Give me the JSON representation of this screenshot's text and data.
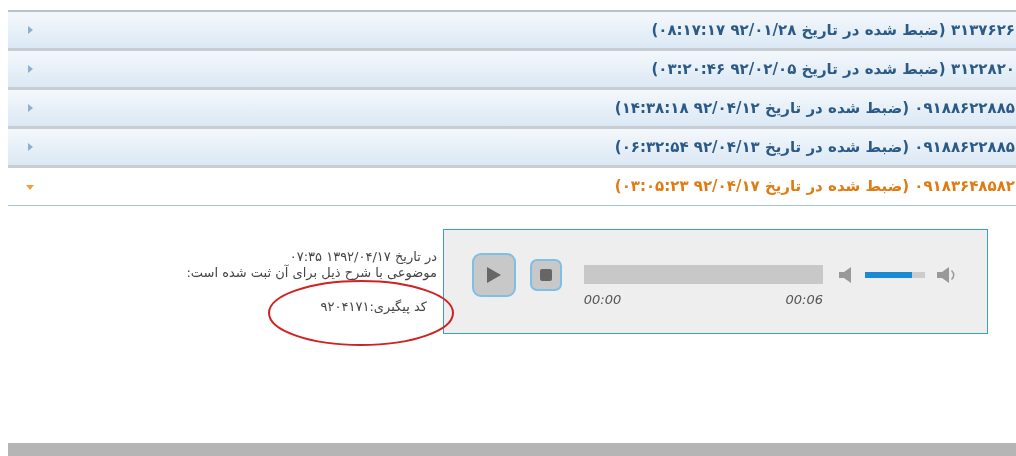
{
  "rows": [
    {
      "number": "۳۱۳۷۶۲۶",
      "label": "(ضبط شده در تاریخ ۹۲/۰۱/۲۸ ۰۸:۱۷:۱۷)",
      "expanded": false
    },
    {
      "number": "۳۱۲۲۸۲۰",
      "label": "(ضبط شده در تاریخ ۹۲/۰۲/۰۵ ۰۳:۲۰:۴۶)",
      "expanded": false
    },
    {
      "number": "۰۹۱۸۸۶۲۲۸۸۵",
      "label": "(ضبط شده در تاریخ ۹۲/۰۴/۱۲ ۱۴:۳۸:۱۸)",
      "expanded": false
    },
    {
      "number": "۰۹۱۸۸۶۲۲۸۸۵",
      "label": "(ضبط شده در تاریخ ۹۲/۰۴/۱۳ ۰۶:۳۲:۵۴)",
      "expanded": false
    },
    {
      "number": "۰۹۱۸۳۶۴۸۵۸۲",
      "label": "(ضبط شده در تاریخ ۹۲/۰۴/۱۷ ۰۳:۰۵:۲۳)",
      "expanded": true
    }
  ],
  "player": {
    "current_time": "00:00",
    "duration": "00:06",
    "volume": {
      "level": 0.78
    }
  },
  "details": {
    "date_line": "در تاریخ ۱۳۹۲/۰۴/۱۷ ۰۷:۳۵",
    "description": "موضوعی با شرح ذیل برای آن ثبت شده است:",
    "tracking_code": "کد پیگیری:۹۲۰۴۱۷۱"
  }
}
